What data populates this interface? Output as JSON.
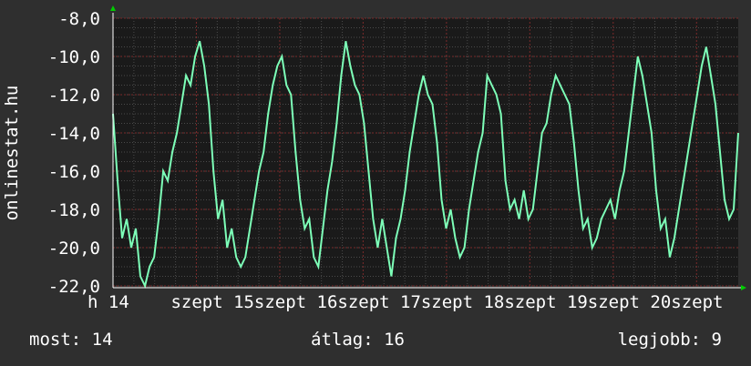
{
  "watermark": "onlinestat.hu",
  "stats": {
    "now_label": "most:",
    "now_value": "14",
    "avg_label": "átlag:",
    "avg_value": "16",
    "best_label": "legjobb:",
    "best_value": "9"
  },
  "colors": {
    "background": "#2f2f2f",
    "plot_background": "#1a1a1a",
    "line": "#7dffb8",
    "grid_major": "#7a2a2a",
    "grid_minor": "#4a4a4a",
    "axis": "#ffffff",
    "arrow": "#00cc00"
  },
  "chart_data": {
    "type": "line",
    "title": "",
    "xlabel": "",
    "ylabel": "",
    "ylim": [
      -22,
      -8
    ],
    "y_ticks": [
      "-8,0",
      "-10,0",
      "-12,0",
      "-14,0",
      "-16,0",
      "-18,0",
      "-20,0",
      "-22,0"
    ],
    "x_ticks": [
      "h 14",
      "szept 15",
      "szept 16",
      "szept 17",
      "szept 18",
      "szept 19",
      "szept 20",
      "szept"
    ],
    "grid": true,
    "series": [
      {
        "values": [
          -13.0,
          -16.5,
          -19.5,
          -18.5,
          -20.0,
          -19.0,
          -21.5,
          -22.0,
          -21.0,
          -20.5,
          -18.5,
          -16.0,
          -16.5,
          -15.0,
          -14.0,
          -12.5,
          -11.0,
          -11.5,
          -10.0,
          -9.2,
          -10.5,
          -12.5,
          -16.0,
          -18.5,
          -17.5,
          -20.0,
          -19.0,
          -20.5,
          -21.0,
          -20.5,
          -19.0,
          -17.5,
          -16.0,
          -15.0,
          -13.0,
          -11.5,
          -10.5,
          -10.0,
          -11.5,
          -12.0,
          -15.0,
          -17.5,
          -19.0,
          -18.5,
          -20.5,
          -21.0,
          -19.0,
          -17.0,
          -15.5,
          -13.5,
          -11.0,
          -9.2,
          -10.5,
          -11.5,
          -12.0,
          -13.5,
          -16.0,
          -18.5,
          -20.0,
          -18.5,
          -20.0,
          -21.5,
          -19.5,
          -18.5,
          -17.0,
          -15.0,
          -13.5,
          -12.0,
          -11.0,
          -12.0,
          -12.5,
          -14.5,
          -17.5,
          -19.0,
          -18.0,
          -19.5,
          -20.5,
          -20.0,
          -18.0,
          -16.5,
          -15.0,
          -14.0,
          -11.0,
          -11.5,
          -12.0,
          -13.0,
          -16.5,
          -18.0,
          -17.5,
          -18.5,
          -17.0,
          -18.5,
          -18.0,
          -16.0,
          -14.0,
          -13.5,
          -12.0,
          -11.0,
          -11.5,
          -12.0,
          -12.5,
          -14.5,
          -17.0,
          -19.0,
          -18.5,
          -20.0,
          -19.5,
          -18.5,
          -18.0,
          -17.5,
          -18.5,
          -17.0,
          -16.0,
          -14.0,
          -12.0,
          -10.0,
          -11.0,
          -12.5,
          -14.0,
          -17.0,
          -19.0,
          -18.5,
          -20.5,
          -19.5,
          -18.0,
          -16.5,
          -15.0,
          -13.5,
          -12.0,
          -10.5,
          -9.5,
          -11.0,
          -12.5,
          -15.0,
          -17.5,
          -18.5,
          -18.0,
          -14.0
        ]
      }
    ]
  }
}
